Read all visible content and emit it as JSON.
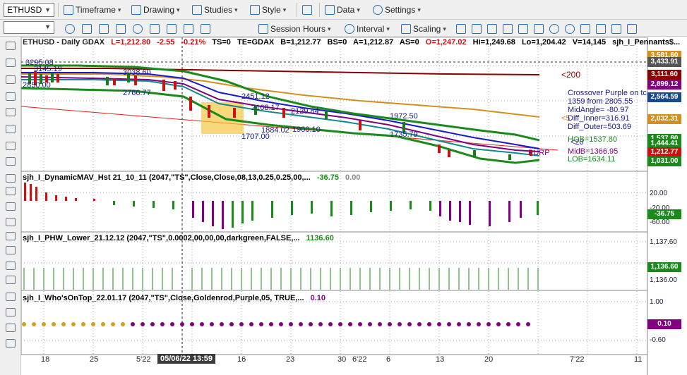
{
  "toolbar1": {
    "symbol": "ETHUSD",
    "timeframe": "Timeframe",
    "drawing": "Drawing",
    "studies": "Studies",
    "style": "Style",
    "data": "Data",
    "settings": "Settings"
  },
  "toolbar2": {
    "session_hours": "Session Hours",
    "interval": "Interval",
    "scaling": "Scaling"
  },
  "header": {
    "title": "ETHUSD - Daily  GDAX",
    "last": "L=1,212.80",
    "chg": "-2.55",
    "pct": "-0.21%",
    "ts": "TS=0",
    "te": "TE=GDAX",
    "b": "B=1,212.77",
    "bs": "BS=0",
    "a": "A=1,212.87",
    "as": "AS=0",
    "open": "O=1,247.02",
    "hi": "Hi=1,249.68",
    "lo": "Lo=1,204.42",
    "vol": "V=14,145",
    "study": "sjh_I_Pennants$..."
  },
  "price_labels": {
    "p1": "3295.08",
    "p2": "3145.19",
    "p3": "2850.00",
    "p4": "3038.60",
    "p5": "2766.77",
    "p6": "2451.12",
    "p7": "2168.17",
    "p8": "2129.84",
    "p9": "1884.02",
    "p10": "1900.10",
    "p11": "1707.00",
    "p12": "1972.50",
    "p13": "1735.79",
    "lt200": "<200",
    "lt50": "<5",
    "lt20": "<20",
    "purple": "PURP",
    "hob": "HOB=1537.80",
    "lob": "LOB=1634.11",
    "mid": "MidB=1366.95"
  },
  "crossover": {
    "l1": "Crossover Purple on tc",
    "l2": "1359 from 2805.55",
    "l3": "MidAngle= -80.97",
    "l4": "Diff_Inner=316.91",
    "l5": "Diff_Outer=503.69"
  },
  "axis_price": {
    "a1": "3,581.60",
    "a2": "3,433.91",
    "a3": "3,111.60",
    "a4": "2,899.12",
    "a5": "2,564.59",
    "a6": "2,032.31",
    "a7": "1,537.80",
    "a8": "1,444.41",
    "a9": "1,212.77",
    "a10": "1,031.00"
  },
  "panel2": {
    "title": "sjh_I_DynamicMAV_Hst 21_10_11 (2047,\"TS\",Close,Close,08,13,0.25,0.25,00,...",
    "v1": "-36.75",
    "v2": "0.00",
    "ax1": "20.00",
    "ax2": "-20.00",
    "ax3": "-36.75",
    "ax4": "-60.00"
  },
  "panel3": {
    "title": "sjh_I_PHW_Lower_21.12.12 (2047,\"TS\",0.0002,00,00,00,darkgreen,FALSE,...",
    "v1": "1136.60",
    "ax1": "1,137.60",
    "ax2": "1,136.60",
    "ax3": "1,136.00"
  },
  "panel4": {
    "title": "sjh_I_Who'sOnTop_22.01.17 (2047,\"TS\",Close,Goldenrod,Purple,05, TRUE,...",
    "v1": "0.10",
    "ax1": "1.00",
    "ax2": "0.10",
    "ax3": "-0.60"
  },
  "xaxis": {
    "t1": "18",
    "t2": "25",
    "t3": "5'22",
    "cursor": "05/06/22 13:59",
    "t4": "16",
    "t5": "23",
    "t6": "30",
    "t7": "6'22",
    "t8": "6",
    "t9": "13",
    "t10": "20",
    "t11": "7'22",
    "t12": "11"
  },
  "colors": {
    "up": "#1a7a1a",
    "down": "#cc1111",
    "ma200": "#8b0000",
    "ma50": "#d4901e",
    "purple": "#800080",
    "green": "#1a8a1a"
  }
}
